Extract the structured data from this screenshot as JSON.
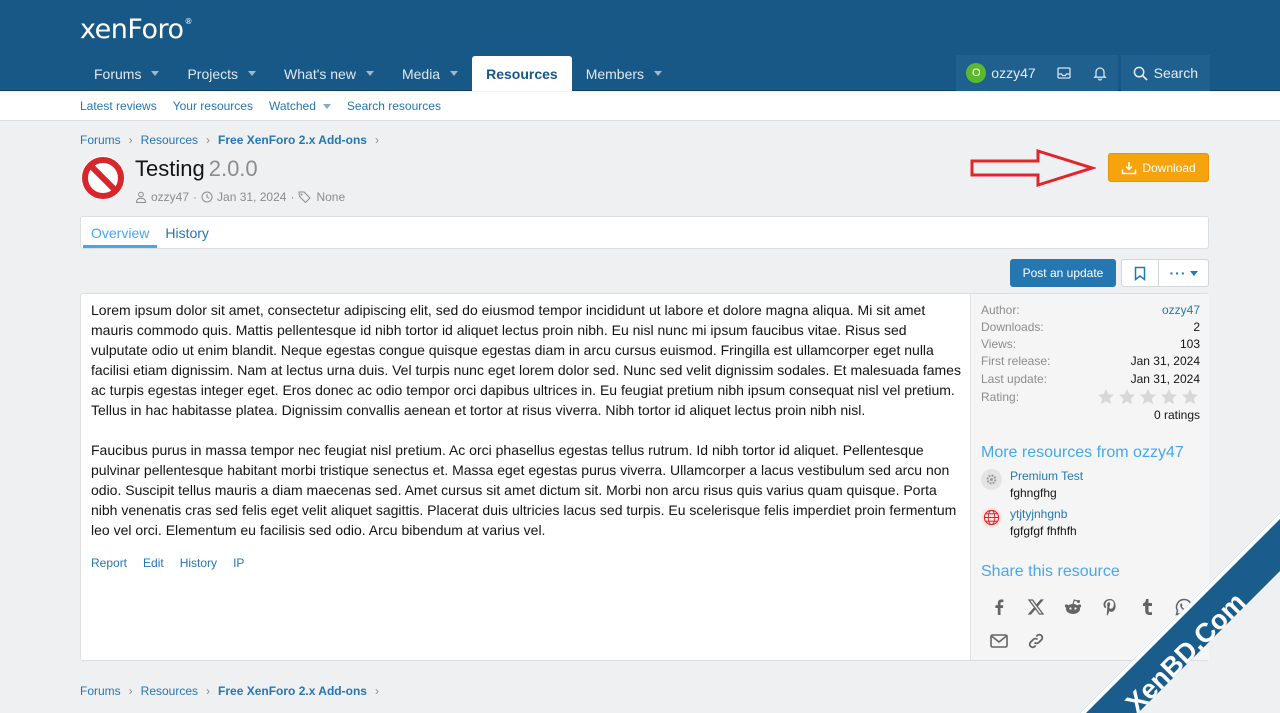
{
  "header": {
    "logo": "xenForo",
    "logo_mark": "®",
    "nav": [
      {
        "label": "Forums"
      },
      {
        "label": "Projects"
      },
      {
        "label": "What's new"
      },
      {
        "label": "Media"
      },
      {
        "label": "Resources",
        "active": true
      },
      {
        "label": "Members"
      }
    ],
    "user": {
      "avatar_letter": "O",
      "name": "ozzy47"
    },
    "search_label": "Search"
  },
  "subnav": [
    "Latest reviews",
    "Your resources",
    "Watched",
    "Search resources"
  ],
  "breadcrumbs": [
    "Forums",
    "Resources",
    "Free XenForo 2.x Add-ons"
  ],
  "resource": {
    "title": "Testing",
    "version": "2.0.0",
    "author": "ozzy47",
    "date": "Jan 31, 2024",
    "tags": "None",
    "download_label": "Download"
  },
  "tabs": [
    "Overview",
    "History"
  ],
  "actions": {
    "post_update": "Post an update"
  },
  "content": {
    "paragraphs": [
      "Lorem ipsum dolor sit amet, consectetur adipiscing elit, sed do eiusmod tempor incididunt ut labore et dolore magna aliqua. Mi sit amet mauris commodo quis. Mattis pellentesque id nibh tortor id aliquet lectus proin nibh. Eu nisl nunc mi ipsum faucibus vitae. Risus sed vulputate odio ut enim blandit. Neque egestas congue quisque egestas diam in arcu cursus euismod. Fringilla est ullamcorper eget nulla facilisi etiam dignissim. Nam at lectus urna duis. Vel turpis nunc eget lorem dolor sed. Nunc sed velit dignissim sodales. Et malesuada fames ac turpis egestas integer eget. Eros donec ac odio tempor orci dapibus ultrices in. Eu feugiat pretium nibh ipsum consequat nisl vel pretium. Tellus in hac habitasse platea. Dignissim convallis aenean et tortor at risus viverra. Nibh tortor id aliquet lectus proin nibh nisl.",
      "Faucibus purus in massa tempor nec feugiat nisl pretium. Ac orci phasellus egestas tellus rutrum. Id nibh tortor id aliquet. Pellentesque pulvinar pellentesque habitant morbi tristique senectus et. Massa eget egestas purus viverra. Ullamcorper a lacus vestibulum sed arcu non odio. Suscipit tellus mauris a diam maecenas sed. Amet cursus sit amet dictum sit. Morbi non arcu risus quis varius quam quisque. Porta nibh venenatis cras sed felis eget velit aliquet sagittis. Placerat duis ultricies lacus sed turpis. Eu scelerisque felis imperdiet proin fermentum leo vel orci. Elementum eu facilisis sed odio. Arcu bibendum at varius vel."
    ],
    "links": [
      "Report",
      "Edit",
      "History",
      "IP"
    ]
  },
  "info": {
    "author_label": "Author:",
    "author": "ozzy47",
    "downloads_label": "Downloads:",
    "downloads": "2",
    "views_label": "Views:",
    "views": "103",
    "first_release_label": "First release:",
    "first_release": "Jan 31, 2024",
    "last_update_label": "Last update:",
    "last_update": "Jan 31, 2024",
    "rating_label": "Rating:",
    "rating_value": 0,
    "rating_max": 5,
    "ratings": "0 ratings"
  },
  "more_resources": {
    "heading": "More resources from ozzy47",
    "items": [
      {
        "title": "Premium Test",
        "desc": "fghngfhg",
        "icon": "gear-icon"
      },
      {
        "title": "ytjtyjnhgnb",
        "desc": "fgfgfgf fhfhfh",
        "icon": "globe-icon"
      }
    ]
  },
  "share": {
    "heading": "Share this resource",
    "icons": [
      "facebook-icon",
      "x-icon",
      "reddit-icon",
      "pinterest-icon",
      "tumblr-icon",
      "whatsapp-icon",
      "email-icon",
      "link-icon"
    ]
  },
  "watermark": "XenBD.Com",
  "colors": {
    "header": "#185886",
    "accent": "#2577b1",
    "download": "#f7a30c",
    "heading": "#47a7eb"
  }
}
